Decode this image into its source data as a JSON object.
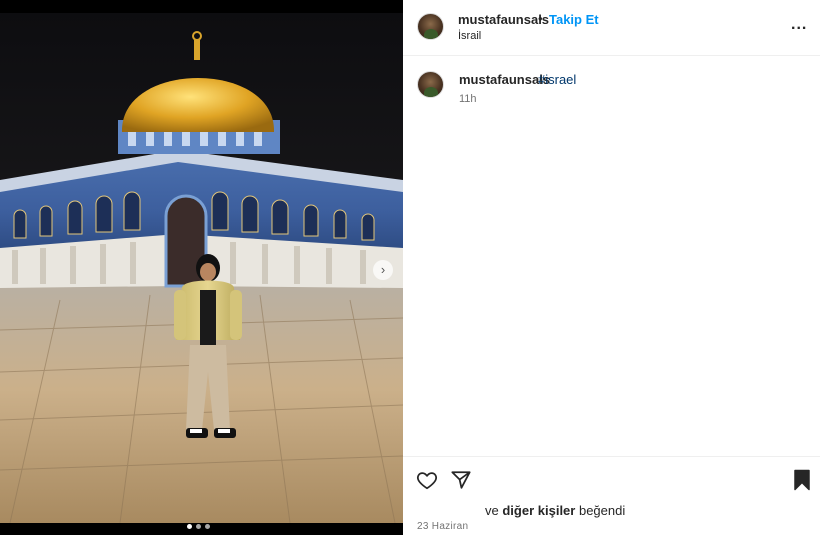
{
  "header": {
    "username": "mustafaunsals",
    "separator": "•",
    "follow_label": "Takip Et",
    "location": "İsrail",
    "more_label": "..."
  },
  "caption": {
    "username": "mustafaunsals",
    "hashtag": "#israel",
    "time": "11h"
  },
  "likes": {
    "prefix": "ve",
    "bold": "diğer kişiler",
    "suffix": "beğendi"
  },
  "date": "23 Haziran",
  "carousel": {
    "total": 3,
    "active_index": 0,
    "next_glyph": "›"
  },
  "icons": [
    "like-icon",
    "share-icon",
    "save-icon",
    "more-icon",
    "chevron-right-icon"
  ],
  "colors": {
    "link_blue": "#0095f6",
    "hashtag_blue": "#00376b",
    "muted": "#737373"
  }
}
